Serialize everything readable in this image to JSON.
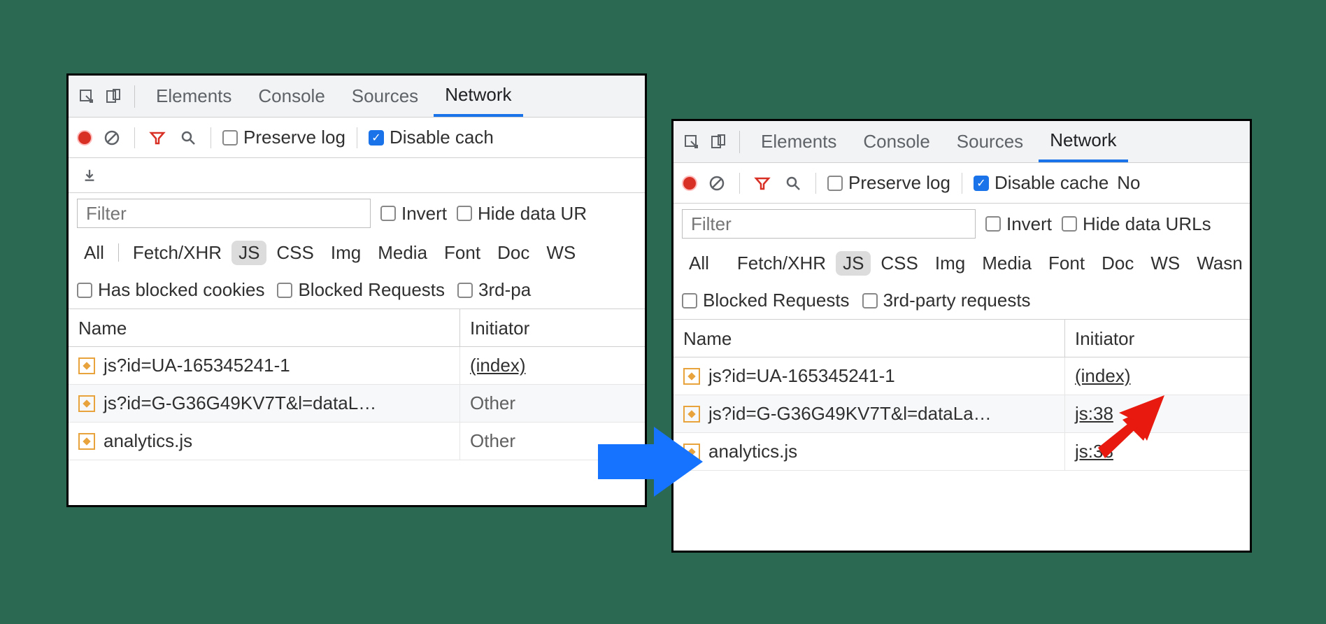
{
  "tabs": {
    "elements": "Elements",
    "console": "Console",
    "sources": "Sources",
    "network": "Network"
  },
  "toolbar": {
    "preserve": "Preserve log",
    "disable_cache_left": "Disable cach",
    "disable_cache_right": "Disable cache",
    "no_right": "No"
  },
  "filter": {
    "placeholder": "Filter",
    "invert": "Invert",
    "hide_urls_left": "Hide data UR",
    "hide_urls_right": "Hide data URLs"
  },
  "types": {
    "all": "All",
    "fetch": "Fetch/XHR",
    "js": "JS",
    "css": "CSS",
    "img": "Img",
    "media": "Media",
    "font": "Font",
    "doc": "Doc",
    "ws": "WS",
    "wasm": "Wasn"
  },
  "flags": {
    "blocked_cookies": "Has blocked cookies",
    "blocked_requests": "Blocked Requests",
    "third_party_left": "3rd-pa",
    "third_party_right": "3rd-party requests"
  },
  "cols": {
    "name": "Name",
    "initiator": "Initiator"
  },
  "left_rows": [
    {
      "name": "js?id=UA-165345241-1",
      "initiator": "(index)",
      "link": true
    },
    {
      "name": "js?id=G-G36G49KV7T&l=dataL…",
      "initiator": "Other",
      "link": false
    },
    {
      "name": "analytics.js",
      "initiator": "Other",
      "link": false
    }
  ],
  "right_rows": [
    {
      "name": "js?id=UA-165345241-1",
      "initiator": "(index)",
      "link": true
    },
    {
      "name": "js?id=G-G36G49KV7T&l=dataLa…",
      "initiator": "js:38",
      "link": true
    },
    {
      "name": "analytics.js",
      "initiator": "js:38",
      "link": true
    }
  ]
}
